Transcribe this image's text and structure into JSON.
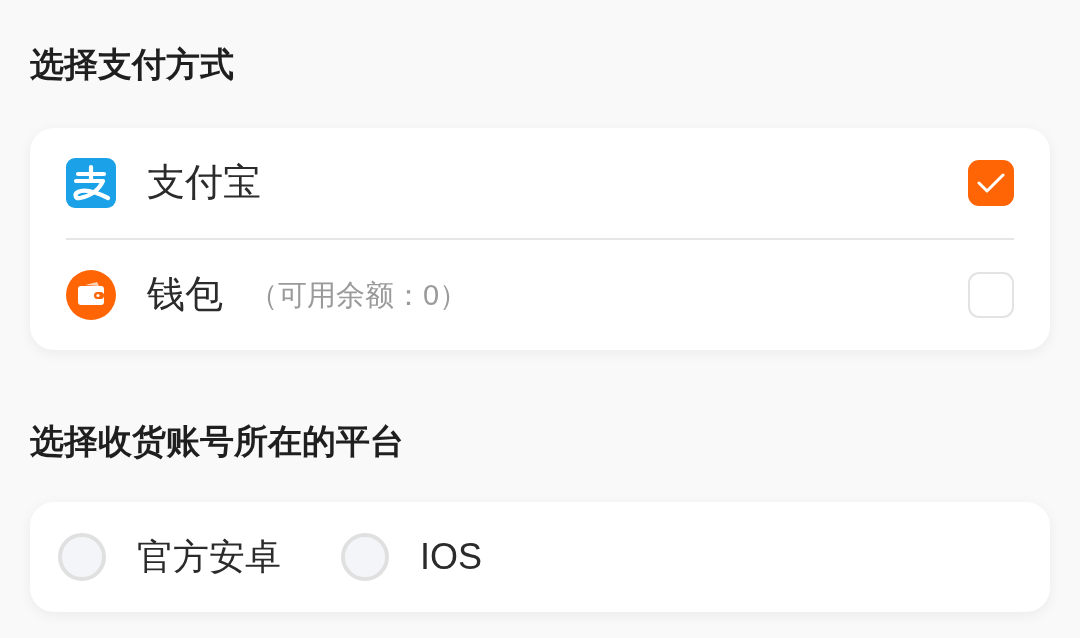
{
  "payment": {
    "title": "选择支付方式",
    "methods": [
      {
        "kind": "alipay",
        "label": "支付宝",
        "checked": true
      },
      {
        "kind": "wallet",
        "label": "钱包",
        "note": "（可用余额：0）",
        "checked": false
      }
    ]
  },
  "platform": {
    "title": "选择收货账号所在的平台",
    "options": [
      {
        "label": "官方安卓",
        "selected": false
      },
      {
        "label": "IOS",
        "selected": false
      }
    ]
  }
}
